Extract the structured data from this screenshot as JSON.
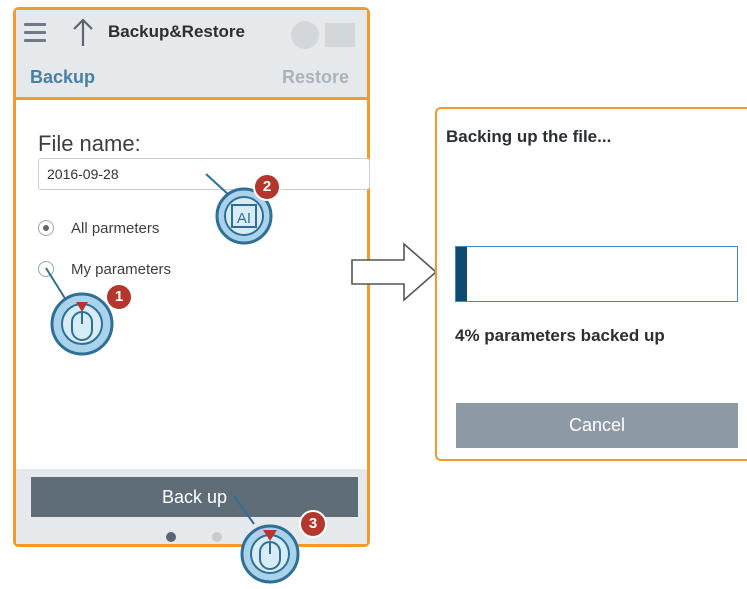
{
  "phone": {
    "title": "Backup&Restore",
    "tabs": {
      "backup": "Backup",
      "restore": "Restore"
    },
    "file_name_label": "File name:",
    "file_name_value": "2016-09-28",
    "options": [
      {
        "label": "All parmeters",
        "selected": true
      },
      {
        "label": "My parameters",
        "selected": false
      }
    ],
    "backup_button": "Back up",
    "page_indicator": {
      "pages": 2,
      "current": 1
    }
  },
  "hints": [
    {
      "step": "1",
      "icon": "touch-tap-icon"
    },
    {
      "step": "2",
      "icon": "keyboard-input-icon",
      "glyph": "AI"
    },
    {
      "step": "3",
      "icon": "touch-tap-icon"
    }
  ],
  "dialog": {
    "title": "Backing up the file...",
    "progress_percent": 4,
    "progress_text": "4% parameters backed up",
    "cancel_button": "Cancel"
  },
  "colors": {
    "accent_orange": "#f29a2e",
    "tab_active": "#4a7fa4",
    "button_dark": "#5f6d79",
    "progress_fill": "#0f4a70",
    "badge_red": "#b3372c",
    "bubble_blue": "#8fc3e0"
  }
}
